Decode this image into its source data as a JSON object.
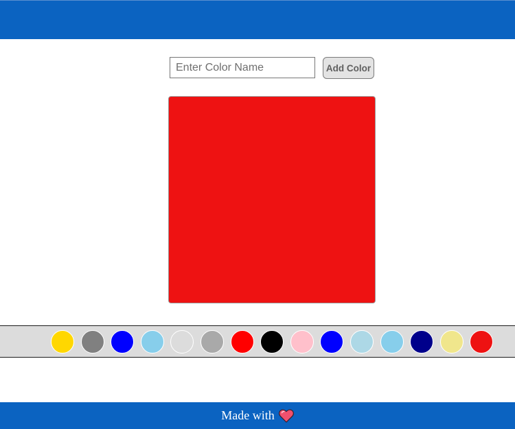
{
  "form": {
    "input_value": "",
    "input_placeholder": "Enter Color Name",
    "add_button_label": "Add Color"
  },
  "preview": {
    "color": "#ee1212"
  },
  "swatches": [
    {
      "color": "#ffd700"
    },
    {
      "color": "#808080"
    },
    {
      "color": "#0000ff"
    },
    {
      "color": "#87ceeb"
    },
    {
      "color": "#dcdcdc"
    },
    {
      "color": "#a9a9a9"
    },
    {
      "color": "#ff0000"
    },
    {
      "color": "#000000"
    },
    {
      "color": "#ffc0cb"
    },
    {
      "color": "#0000ff"
    },
    {
      "color": "#add8e6"
    },
    {
      "color": "#87ceeb"
    },
    {
      "color": "#00008b"
    },
    {
      "color": "#f0e68c"
    },
    {
      "color": "#ee1212"
    }
  ],
  "footer": {
    "text": "Made with",
    "icon": "heart-icon"
  },
  "theme": {
    "header_color": "#0b63c1",
    "footer_color": "#0b63c1"
  }
}
